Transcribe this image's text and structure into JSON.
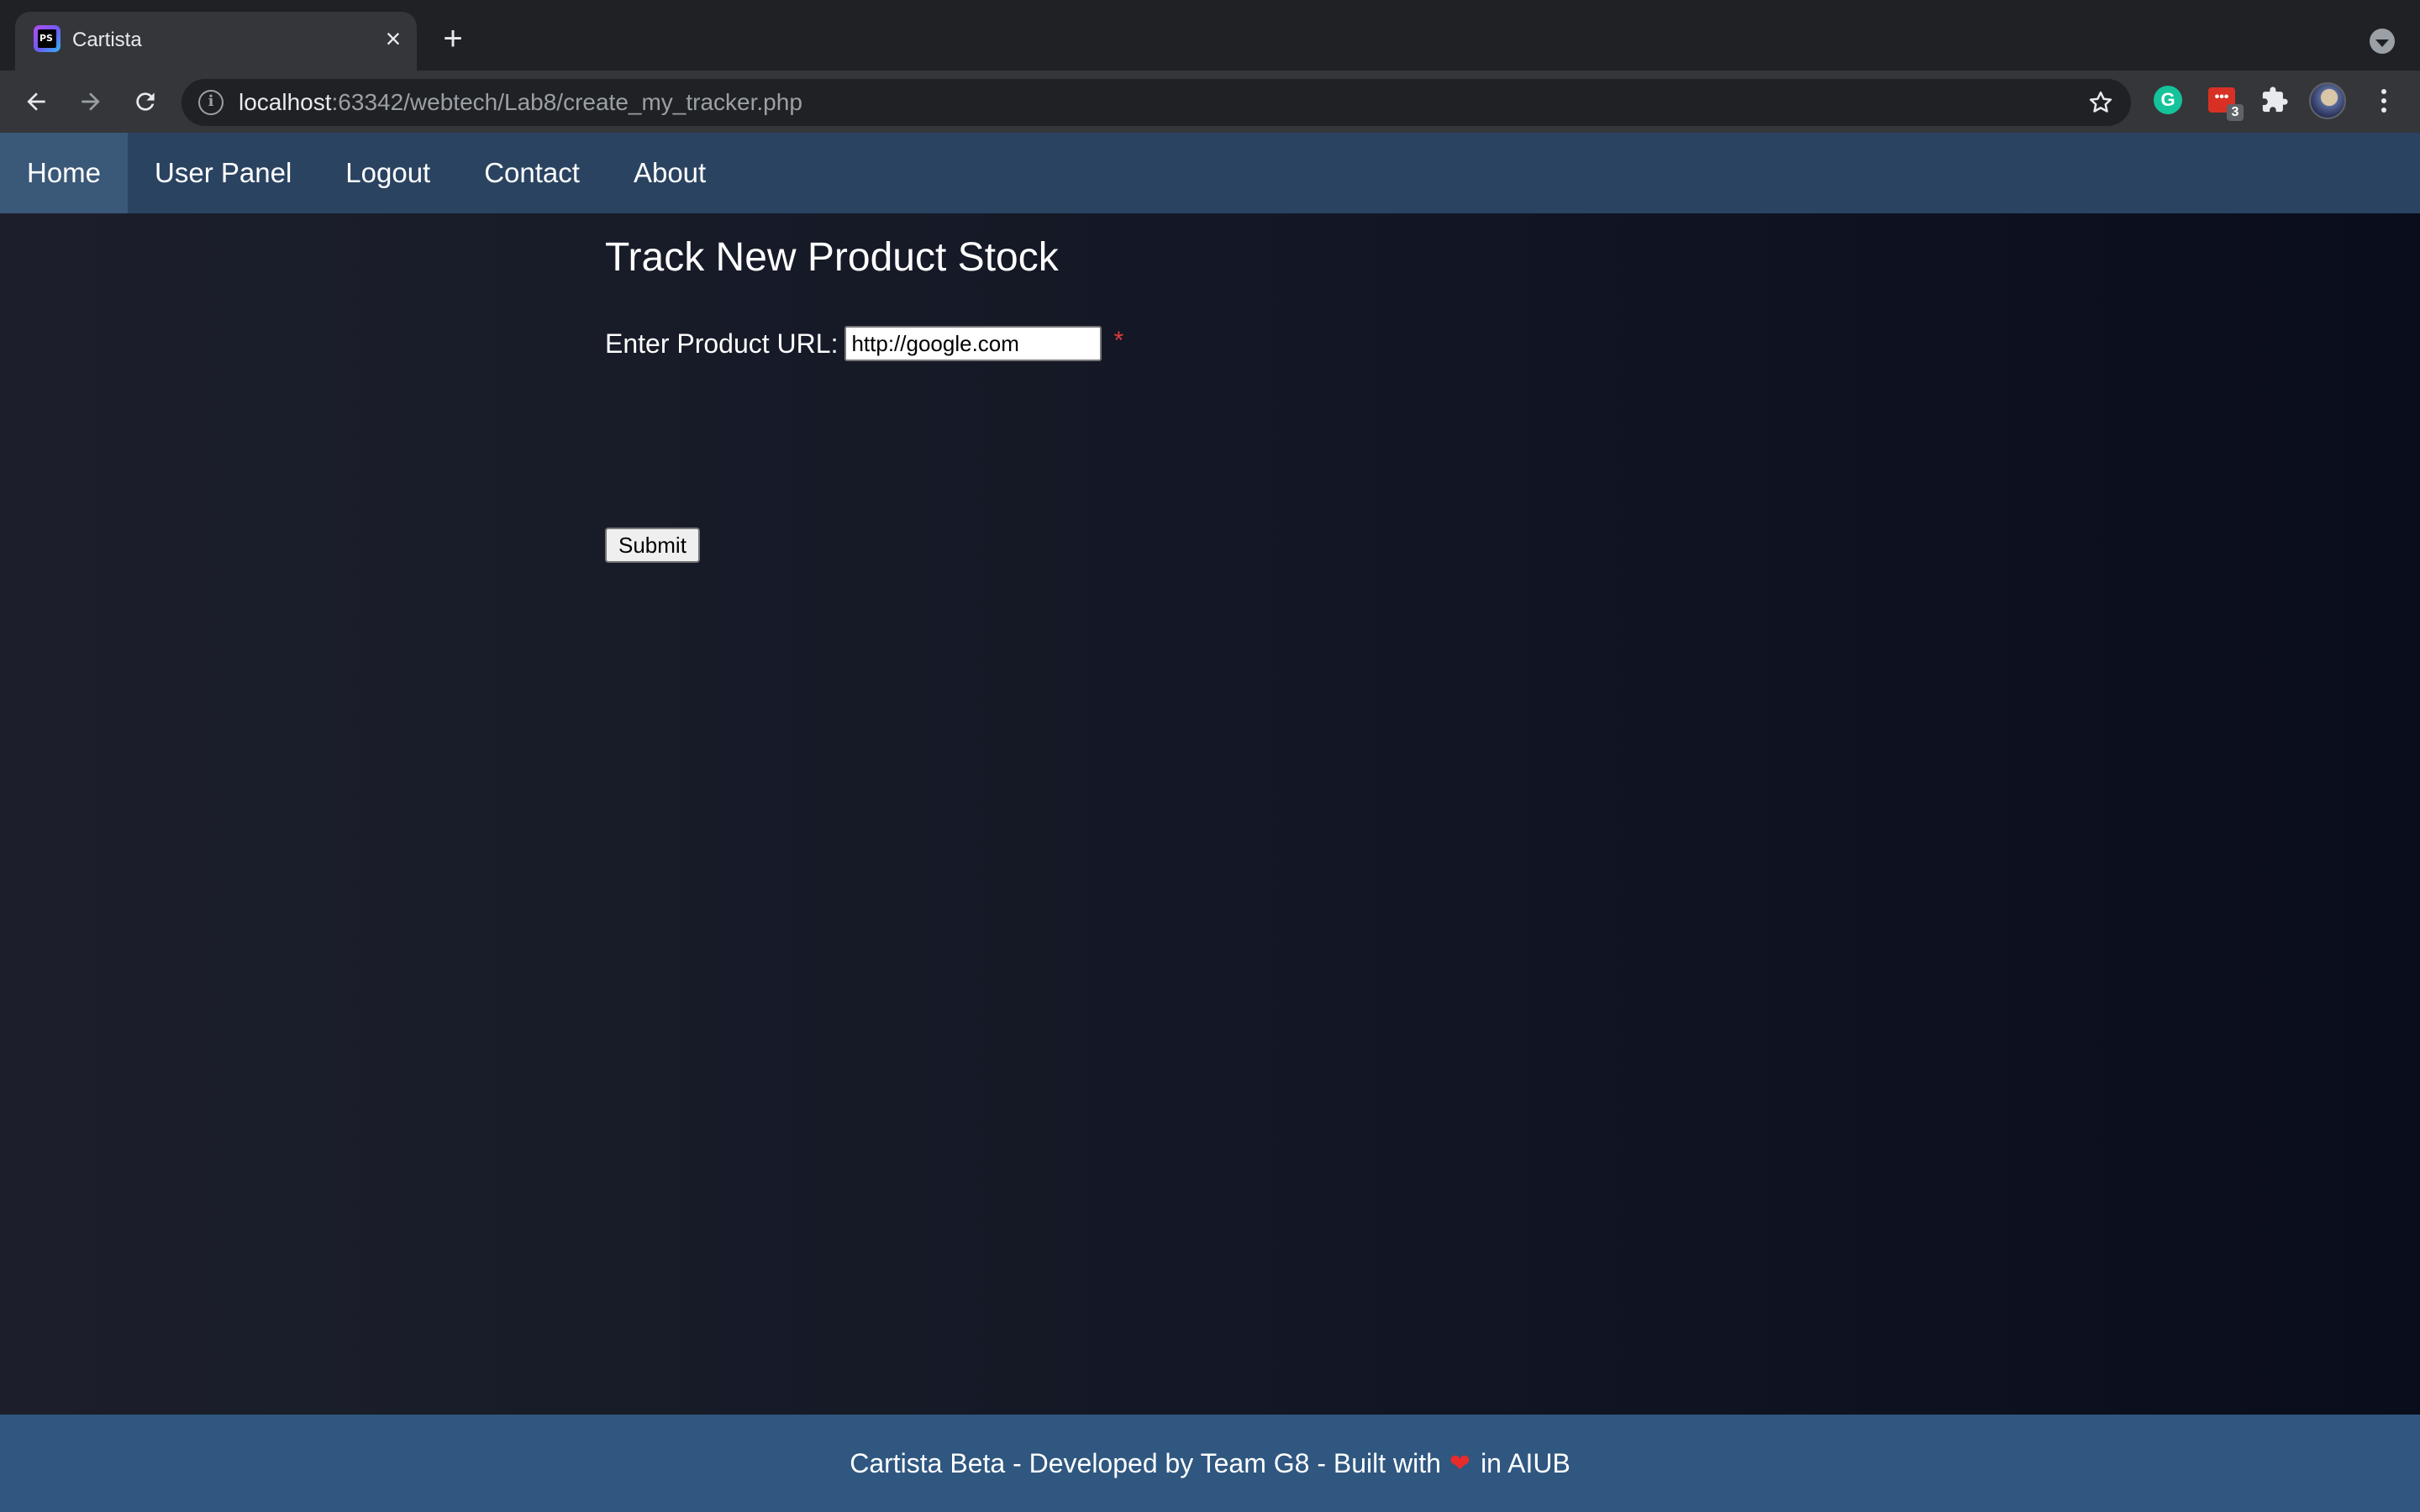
{
  "browser": {
    "tab": {
      "title": "Cartista",
      "favicon_text": "PS"
    },
    "address": {
      "host": "localhost",
      "path": ":63342/webtech/Lab8/create_my_tracker.php"
    },
    "extensions": {
      "grammarly_letter": "G",
      "todo_dots": "•••",
      "todo_badge": "3"
    }
  },
  "navbar": {
    "items": [
      {
        "label": "Home",
        "active": true
      },
      {
        "label": "User Panel",
        "active": false
      },
      {
        "label": "Logout",
        "active": false
      },
      {
        "label": "Contact",
        "active": false
      },
      {
        "label": "About",
        "active": false
      }
    ]
  },
  "main": {
    "heading": "Track New Product Stock",
    "form": {
      "url_label": "Enter Product URL:",
      "url_value": "http://google.com",
      "required_marker": "*",
      "submit_label": "Submit"
    }
  },
  "footer": {
    "text_before": "Cartista Beta - Developed by Team G8 - Built with",
    "heart": "❤",
    "text_after": "in AIUB"
  },
  "colors": {
    "navbar_bg": "#2a4361",
    "nav_active_bg": "#3a5878",
    "footer_bg": "#2f5780",
    "page_bg": "#131725",
    "required": "#e03c3c"
  },
  "icons": [
    "back-arrow-icon",
    "forward-arrow-icon",
    "reload-icon",
    "info-icon",
    "star-icon",
    "puzzle-icon",
    "close-icon",
    "plus-icon",
    "heart-icon"
  ]
}
